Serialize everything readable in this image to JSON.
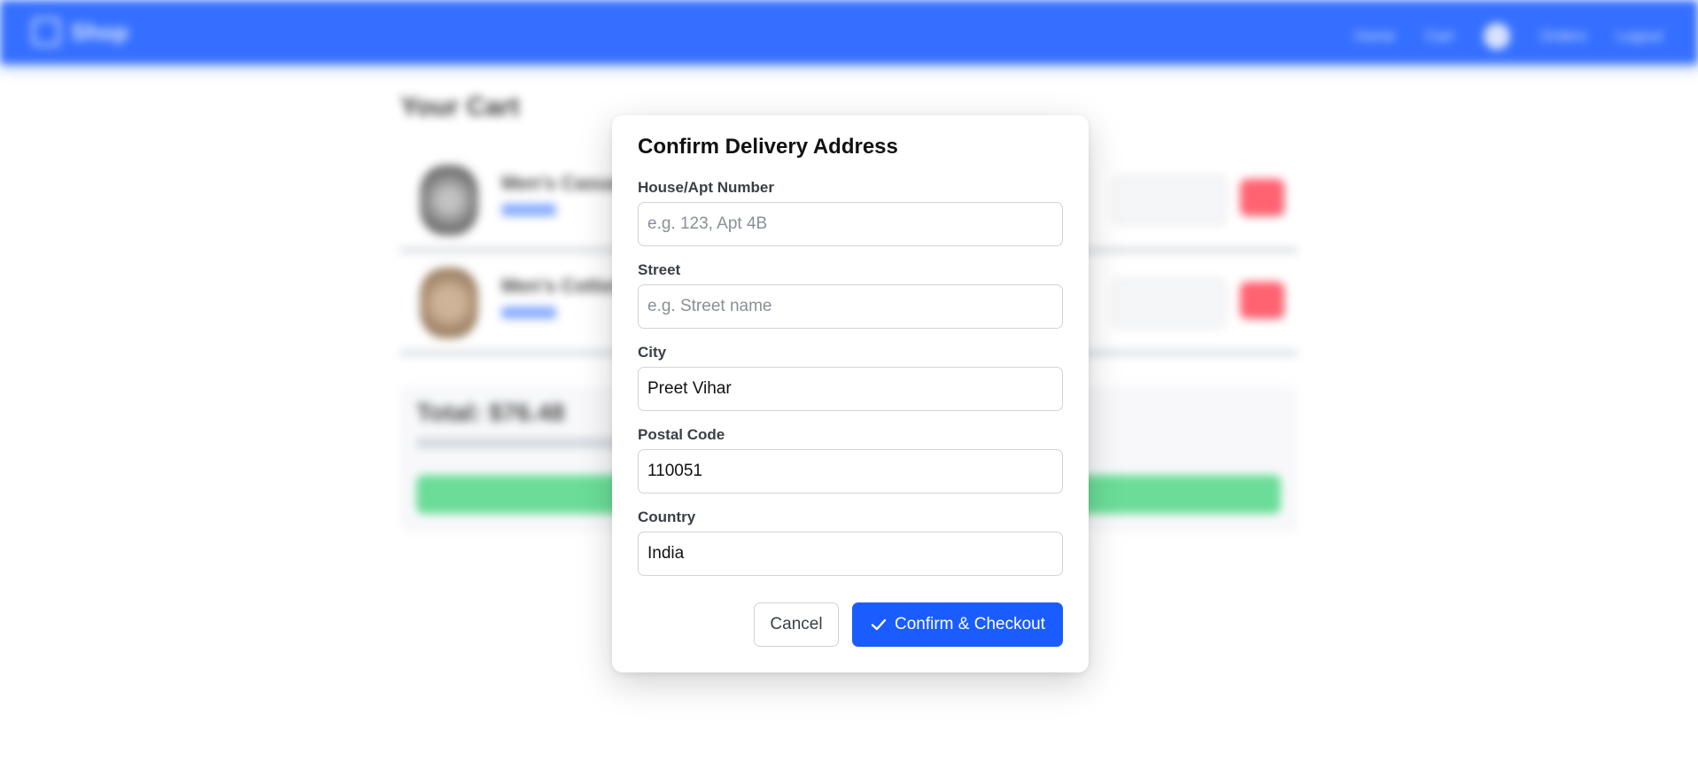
{
  "navbar": {
    "brand": "Shop",
    "links": [
      "Home",
      "Cart",
      "Orders",
      "Logout"
    ]
  },
  "cart": {
    "title": "Your Cart",
    "items": [
      {
        "name": "Men's Casual Shirt"
      },
      {
        "name": "Men's Cotton Jacket"
      }
    ],
    "summary_label": "Total: $76.48"
  },
  "modal": {
    "title": "Confirm Delivery Address",
    "fields": {
      "house": {
        "label": "House/Apt Number",
        "value": "",
        "placeholder": "e.g. 123, Apt 4B"
      },
      "street": {
        "label": "Street",
        "value": "",
        "placeholder": "e.g. Street name"
      },
      "city": {
        "label": "City",
        "value": "Preet Vihar",
        "placeholder": ""
      },
      "postal": {
        "label": "Postal Code",
        "value": "110051",
        "placeholder": ""
      },
      "country": {
        "label": "Country",
        "value": "India",
        "placeholder": ""
      }
    },
    "cancel_label": "Cancel",
    "confirm_label": "Confirm & Checkout",
    "confirm_icon": "check-icon"
  },
  "colors": {
    "primary": "#1a5cff",
    "danger": "#ff4d5e",
    "success": "#57d98a"
  }
}
